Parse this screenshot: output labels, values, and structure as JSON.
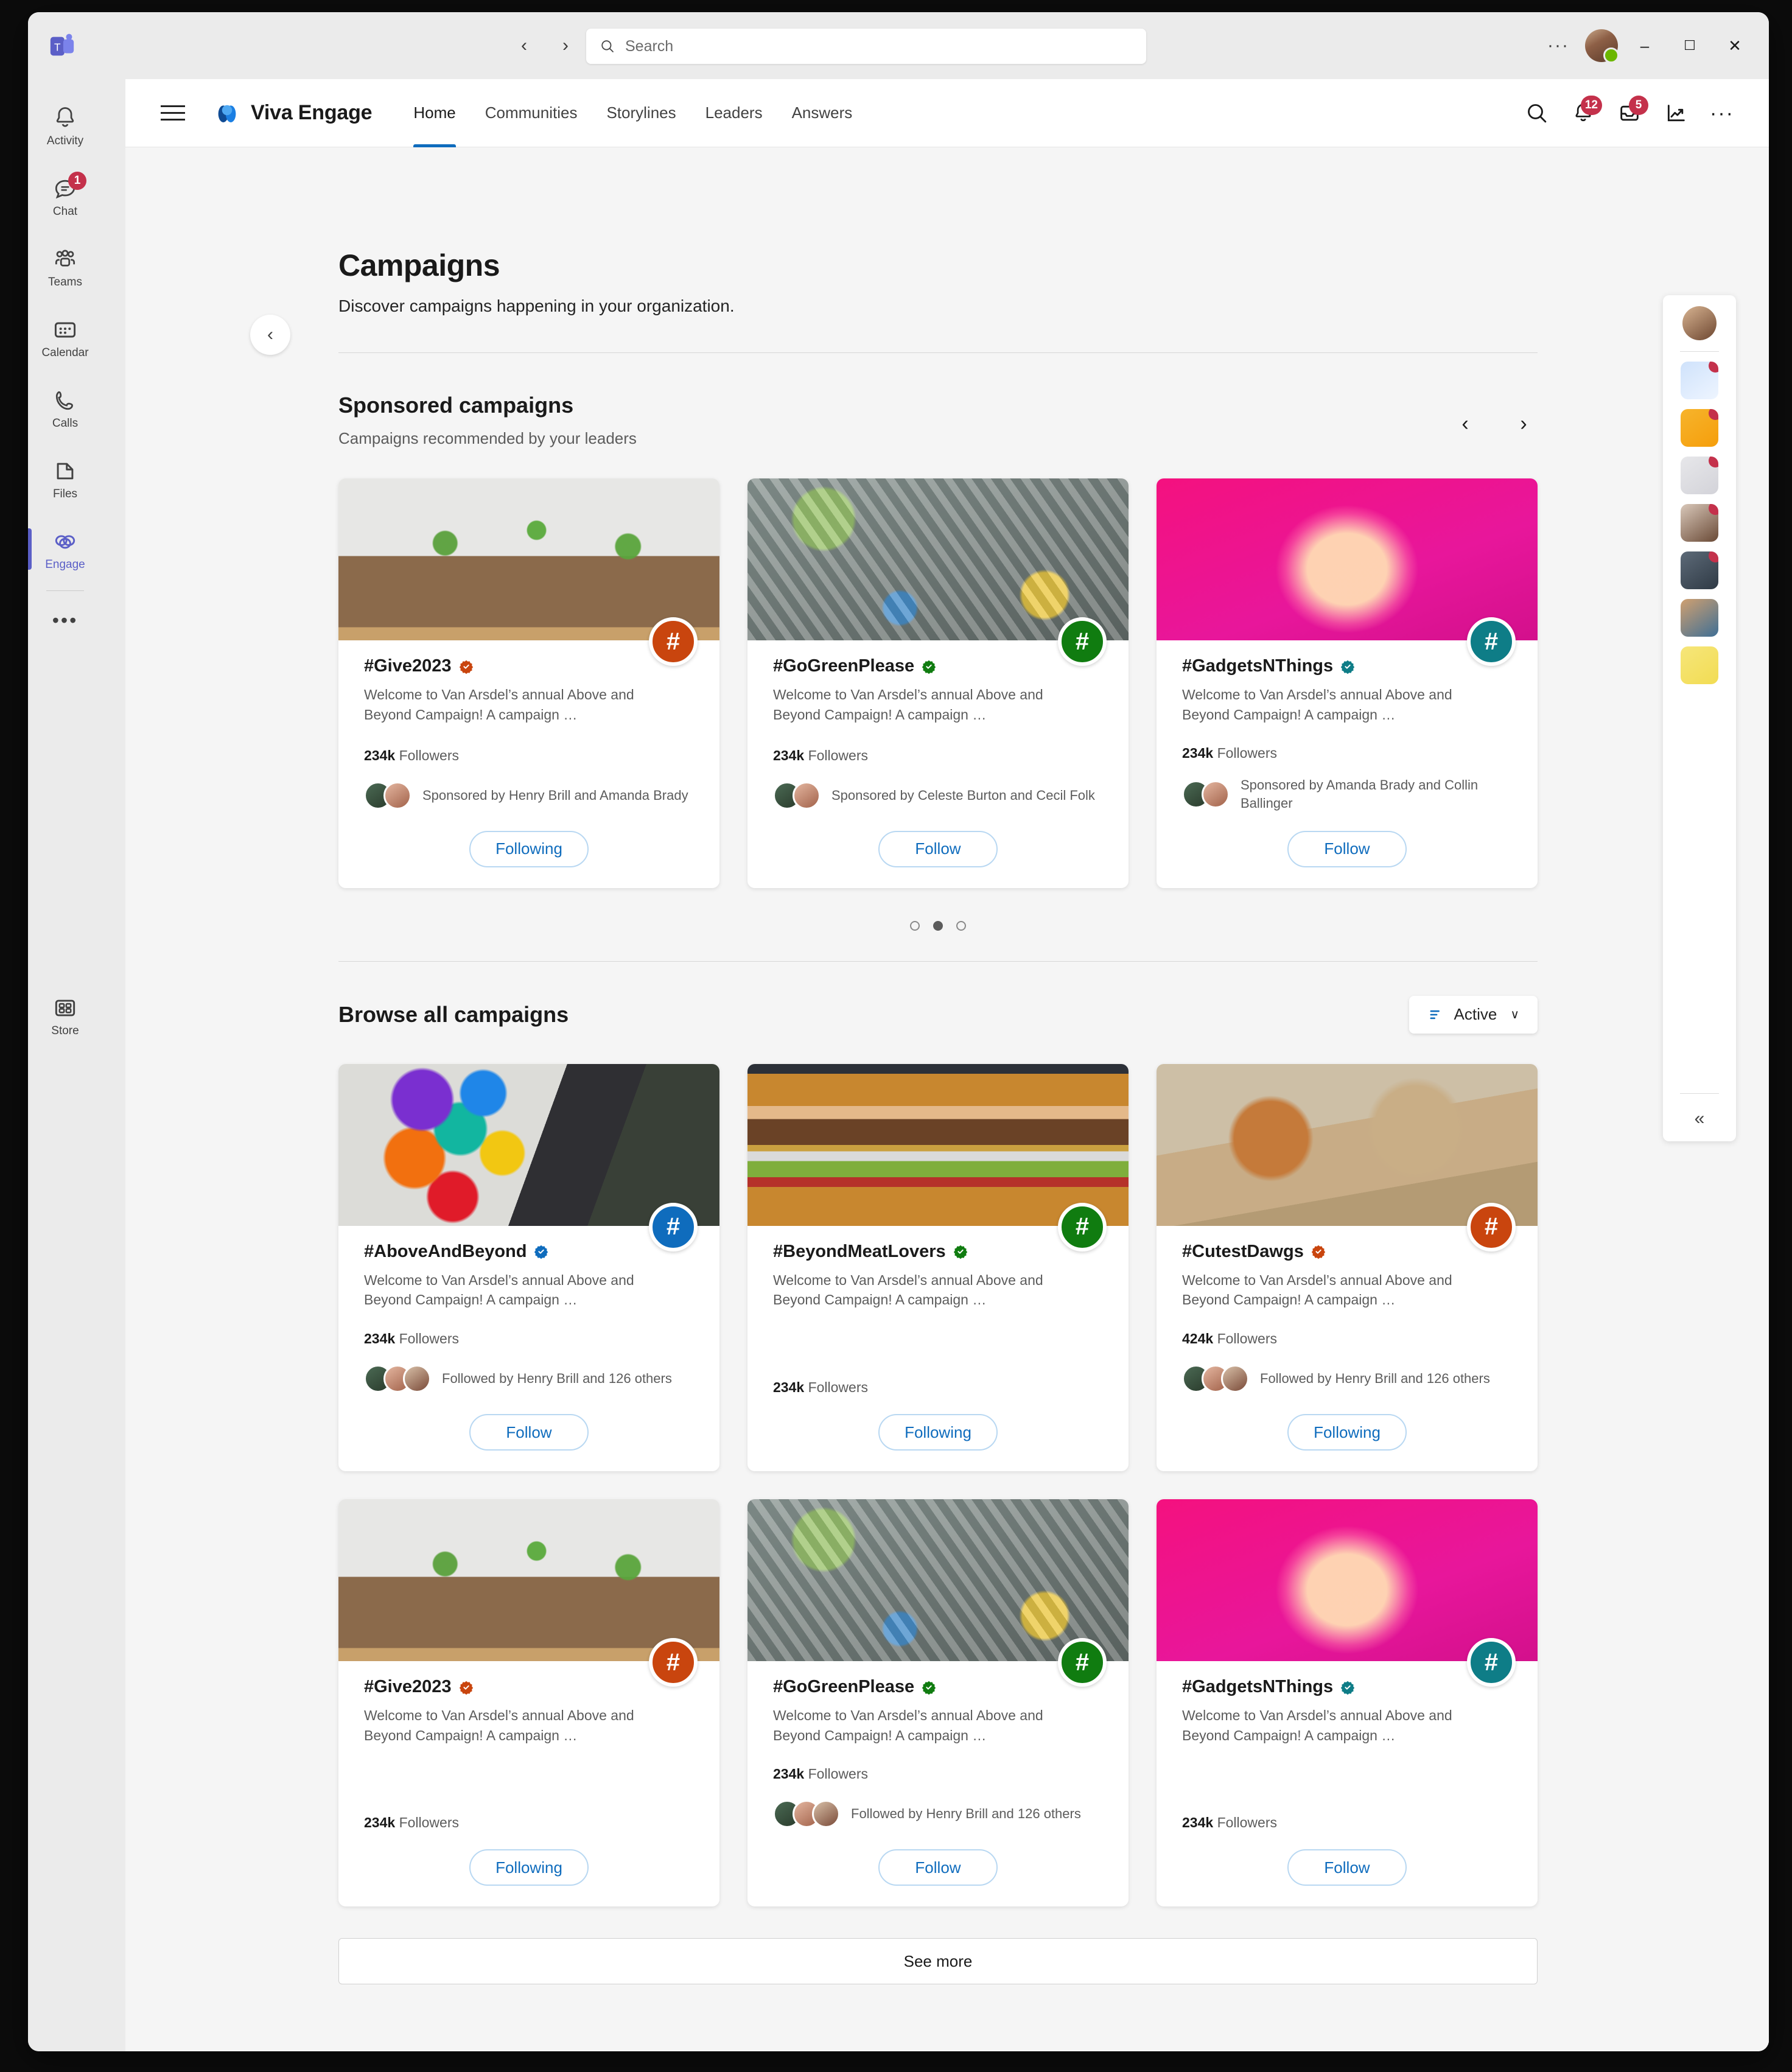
{
  "window": {
    "title_search_placeholder": "Search",
    "back_label": "‹",
    "forward_label": "›",
    "more_label": "···",
    "minimize_label": "–",
    "maximize_label": "☐",
    "close_label": "✕"
  },
  "rail": {
    "items": [
      {
        "name": "activity",
        "label": "Activity",
        "badge": ""
      },
      {
        "name": "chat",
        "label": "Chat",
        "badge": "1"
      },
      {
        "name": "teams",
        "label": "Teams",
        "badge": ""
      },
      {
        "name": "calendar",
        "label": "Calendar",
        "badge": ""
      },
      {
        "name": "calls",
        "label": "Calls",
        "badge": ""
      },
      {
        "name": "files",
        "label": "Files",
        "badge": ""
      },
      {
        "name": "engage",
        "label": "Engage",
        "badge": ""
      }
    ],
    "overflow_label": "•••",
    "store_label": "Store"
  },
  "appnav": {
    "brand": "Viva Engage",
    "tabs": [
      {
        "label": "Home",
        "active": true
      },
      {
        "label": "Communities",
        "active": false
      },
      {
        "label": "Storylines",
        "active": false
      },
      {
        "label": "Leaders",
        "active": false
      },
      {
        "label": "Answers",
        "active": false
      }
    ],
    "icons": [
      {
        "name": "search-icon",
        "badge": ""
      },
      {
        "name": "bell-icon",
        "badge": "12"
      },
      {
        "name": "inbox-icon",
        "badge": "5"
      },
      {
        "name": "analytics-icon",
        "badge": ""
      },
      {
        "name": "more-icon",
        "badge": ""
      }
    ],
    "more_label": "···"
  },
  "page": {
    "title": "Campaigns",
    "subtitle": "Discover campaigns happening in your organization."
  },
  "sponsored": {
    "title": "Sponsored campaigns",
    "subtitle": "Campaigns recommended by your leaders",
    "prev_label": "‹",
    "next_label": "›",
    "dots": [
      false,
      true,
      false
    ],
    "cards": [
      {
        "hashtag": "#Give2023",
        "description": "Welcome to Van Arsdel’s annual Above and Beyond Campaign! A campaign …",
        "followers_count": "234k",
        "followers_label": "Followers",
        "people_text": "Sponsored by Henry Brill and Amanda Brady",
        "button": "Following",
        "accent": "#c9450e",
        "image": "img-plants",
        "avatars": 2
      },
      {
        "hashtag": "#GoGreenPlease",
        "description": "Welcome to Van Arsdel’s annual Above and Beyond Campaign! A campaign …",
        "followers_count": "234k",
        "followers_label": "Followers",
        "people_text": "Sponsored by Celeste Burton and Cecil Folk",
        "button": "Follow",
        "accent": "#107c10",
        "image": "img-bottles",
        "avatars": 2
      },
      {
        "hashtag": "#GadgetsNThings",
        "description": "Welcome to Van Arsdel’s annual Above and Beyond Campaign! A campaign …",
        "followers_count": "234k",
        "followers_label": "Followers",
        "people_text": "Sponsored by Amanda Brady and Collin Ballinger",
        "button": "Follow",
        "accent": "#0e7d87",
        "image": "img-bulb",
        "avatars": 2
      }
    ]
  },
  "browse": {
    "title": "Browse all campaigns",
    "filter_label": "Active",
    "filter_chevron": "∨",
    "see_more_label": "See more",
    "cards": [
      {
        "hashtag": "#AboveAndBeyond",
        "description": "Welcome to Van Arsdel’s annual Above and Beyond Campaign! A campaign …",
        "followers_count": "234k",
        "followers_label": "Followers",
        "people_text": "Followed by Henry Brill and 126 others",
        "button": "Follow",
        "accent": "#0f6cbd",
        "image": "img-balloons",
        "avatars": 3
      },
      {
        "hashtag": "#BeyondMeatLovers",
        "description": "Welcome to Van Arsdel’s annual Above and Beyond Campaign! A campaign …",
        "followers_count": "234k",
        "followers_label": "Followers",
        "people_text": "",
        "button": "Following",
        "accent": "#107c10",
        "image": "img-burger",
        "avatars": 0
      },
      {
        "hashtag": "#CutestDawgs",
        "description": "Welcome to Van Arsdel’s annual Above and Beyond Campaign! A campaign …",
        "followers_count": "424k",
        "followers_label": "Followers",
        "people_text": "Followed by Henry Brill and 126 others",
        "button": "Following",
        "accent": "#c9450e",
        "image": "img-dogs",
        "avatars": 3
      },
      {
        "hashtag": "#Give2023",
        "description": "Welcome to Van Arsdel’s annual Above and Beyond Campaign! A campaign …",
        "followers_count": "234k",
        "followers_label": "Followers",
        "people_text": "",
        "button": "Following",
        "accent": "#c9450e",
        "image": "img-plants",
        "avatars": 0
      },
      {
        "hashtag": "#GoGreenPlease",
        "description": "Welcome to Van Arsdel’s annual Above and Beyond Campaign! A campaign …",
        "followers_count": "234k",
        "followers_label": "Followers",
        "people_text": "Followed by Henry Brill and 126 others",
        "button": "Follow",
        "accent": "#107c10",
        "image": "img-bottles",
        "avatars": 3
      },
      {
        "hashtag": "#GadgetsNThings",
        "description": "Welcome to Van Arsdel’s annual Above and Beyond Campaign! A campaign …",
        "followers_count": "234k",
        "followers_label": "Followers",
        "people_text": "",
        "button": "Follow",
        "accent": "#0e7d87",
        "image": "img-bulb",
        "avatars": 0
      }
    ]
  },
  "right_rail": {
    "apps": [
      {
        "name": "app-icon-1",
        "cls": "rr1",
        "dot": true
      },
      {
        "name": "app-icon-2",
        "cls": "rr2",
        "dot": true
      },
      {
        "name": "app-icon-3",
        "cls": "rr3",
        "dot": true
      },
      {
        "name": "app-icon-4",
        "cls": "rr4",
        "dot": true
      },
      {
        "name": "app-icon-5",
        "cls": "rr5",
        "dot": true
      },
      {
        "name": "app-icon-6",
        "cls": "rr6",
        "dot": false
      },
      {
        "name": "app-icon-7",
        "cls": "rr7",
        "dot": false
      }
    ],
    "collapse_label": "«"
  }
}
